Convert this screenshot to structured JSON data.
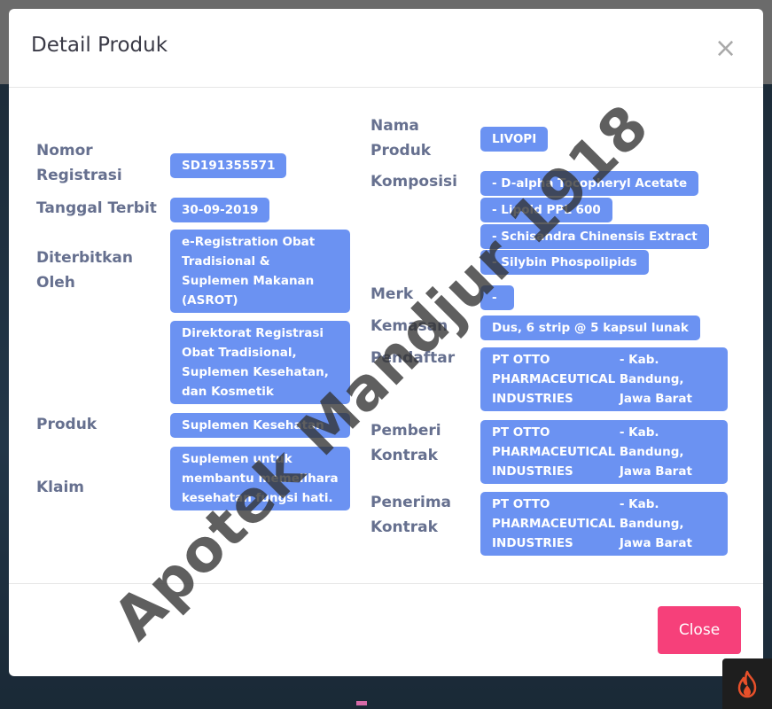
{
  "modal": {
    "title": "Detail Produk",
    "close_icon": "×",
    "close_button": "Close"
  },
  "left": {
    "nomor_registrasi_label": "Nomor Registrasi",
    "nomor_registrasi": "SD191355571",
    "tanggal_terbit_label": "Tanggal Terbit",
    "tanggal_terbit": "30-09-2019",
    "diterbitkan_oleh_label": "Diterbitkan Oleh",
    "diterbitkan_oleh": [
      "e-Registration Obat Tradisional & Suplemen Makanan (ASROT)",
      "Direktorat Registrasi Obat Tradisional, Suplemen Kesehatan, dan Kosmetik"
    ],
    "produk_label": "Produk",
    "produk": "Suplemen Kesehatan",
    "klaim_label": "Klaim",
    "klaim": "Suplemen untuk membantu memelihara kesehatan fungsi hati."
  },
  "right": {
    "nama_produk_label": "Nama Produk",
    "nama_produk": "LIVOPI",
    "komposisi_label": "Komposisi",
    "komposisi": [
      "- D-alpha Tocopheryl Acetate",
      "- Lipoid PPL 600",
      "- Schisandra Chinensis Extract",
      "- Silybin Phospolipids"
    ],
    "merk_label": "Merk",
    "merk": "-",
    "kemasan_label": "Kemasan",
    "kemasan": "Dus, 6 strip @ 5 kapsul lunak",
    "pendaftar_label": "Pendaftar",
    "pendaftar": {
      "name": "PT OTTO PHARMACEUTICAL INDUSTRIES",
      "location": "- Kab. Bandung, Jawa Barat"
    },
    "pemberi_kontrak_label": "Pemberi Kontrak",
    "pemberi_kontrak": {
      "name": "PT OTTO PHARMACEUTICAL INDUSTRIES",
      "location": "- Kab. Bandung, Jawa Barat"
    },
    "penerima_kontrak_label": "Penerima Kontrak",
    "penerima_kontrak": {
      "name": "PT OTTO PHARMACEUTICAL INDUSTRIES",
      "location": "- Kab. Bandung, Jawa Barat"
    }
  },
  "watermark": "Apotek Mandjur 1918",
  "icons": {
    "close": "close-icon",
    "corner": "fire-icon"
  },
  "colors": {
    "chip": "#6b92f2",
    "label": "#66708f",
    "close_button": "#f6407a"
  }
}
